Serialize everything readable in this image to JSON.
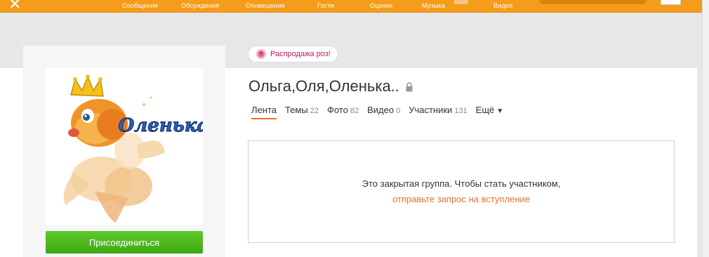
{
  "topbar": {
    "nav": [
      {
        "label": "Сообщения"
      },
      {
        "label": "Обсуждения"
      },
      {
        "label": "Оповещения"
      },
      {
        "label": "Гости"
      },
      {
        "label": "Оценки"
      },
      {
        "label": "Музыка"
      },
      {
        "label": "Видео"
      }
    ]
  },
  "promo": {
    "label": "Распродажа роз!"
  },
  "group": {
    "title": "Ольга,Оля,Оленька..",
    "avatar_text": "Оленька"
  },
  "tabs": [
    {
      "label": "Лента",
      "count": ""
    },
    {
      "label": "Темы",
      "count": "22"
    },
    {
      "label": "Фото",
      "count": "82"
    },
    {
      "label": "Видео",
      "count": "0"
    },
    {
      "label": "Участники",
      "count": "131"
    },
    {
      "label": "Ещё",
      "count": ""
    }
  ],
  "sidebar": {
    "join_label": "Присоединиться"
  },
  "closed_notice": {
    "text": "Это закрытая группа. Чтобы стать участником,",
    "link": "отправьте запрос на вступление"
  },
  "colors": {
    "topbar": "#f59c1a",
    "accent": "#eb722e",
    "join_button": "#4db51d",
    "promo_text": "#c1156a"
  }
}
